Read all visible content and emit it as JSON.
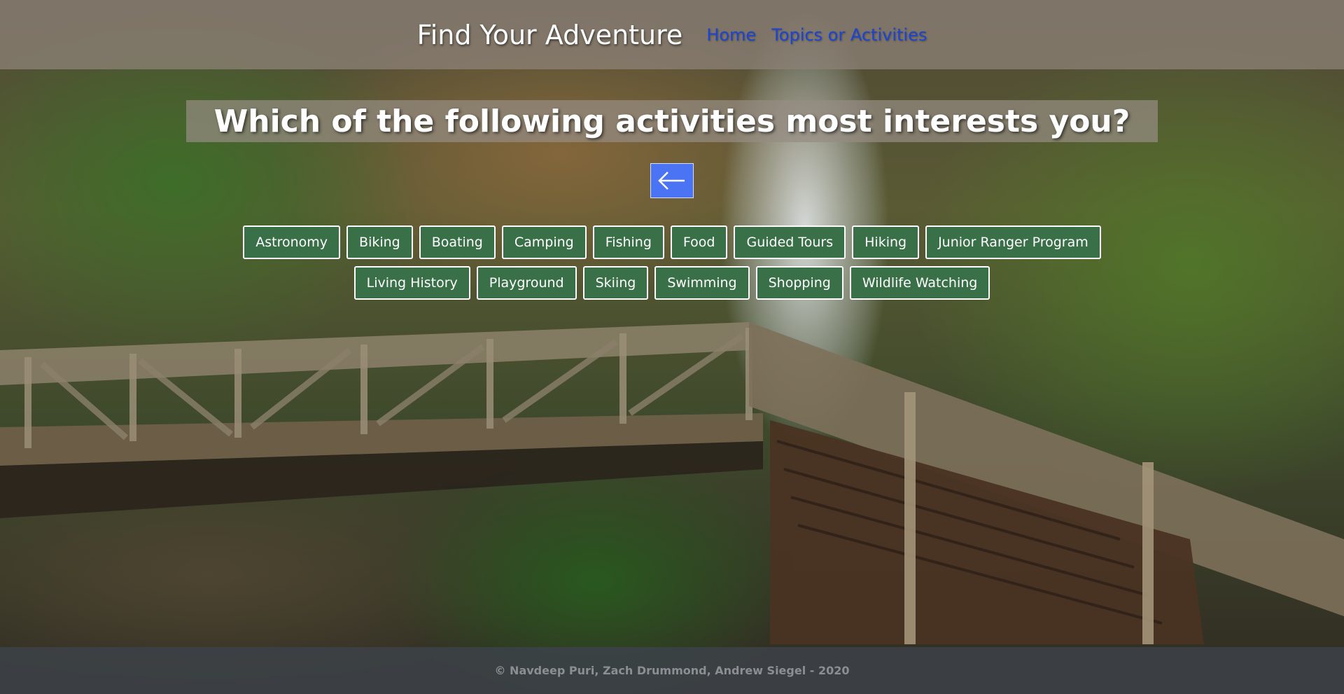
{
  "header": {
    "title": "Find Your Adventure",
    "nav": [
      {
        "label": "Home"
      },
      {
        "label": "Topics or Activities"
      }
    ]
  },
  "question": "Which of the following activities most interests you?",
  "back_button": {
    "icon": "arrow-left-icon"
  },
  "activities": [
    "Astronomy",
    "Biking",
    "Boating",
    "Camping",
    "Fishing",
    "Food",
    "Guided Tours",
    "Hiking",
    "Junior Ranger Program",
    "Living History",
    "Playground",
    "Skiing",
    "Swimming",
    "Shopping",
    "Wildlife Watching"
  ],
  "footer": "© Navdeep Puri, Zach Drummond, Andrew Siegel - 2020",
  "colors": {
    "activity_bg": "#3a7048",
    "back_button_bg": "#4b74f5",
    "nav_link": "#1a44d6"
  }
}
